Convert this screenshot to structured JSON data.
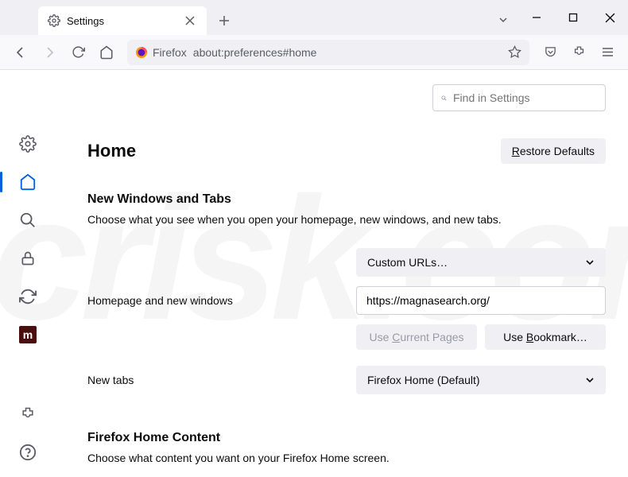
{
  "window": {
    "tab_title": "Settings",
    "chevron": "⌄"
  },
  "toolbar": {
    "url_prefix": "Firefox",
    "url": "about:preferences#home"
  },
  "search": {
    "placeholder": "Find in Settings"
  },
  "page": {
    "title": "Home",
    "restore_label": "Restore Defaults"
  },
  "section1": {
    "title": "New Windows and Tabs",
    "desc": "Choose what you see when you open your homepage, new windows, and new tabs.",
    "dropdown1": "Custom URLs…",
    "homepage_label": "Homepage and new windows",
    "homepage_value": "https://magnasearch.org/",
    "use_current": "Use Current Pages",
    "use_bookmark": "Use Bookmark…",
    "newtabs_label": "New tabs",
    "newtabs_value": "Firefox Home (Default)"
  },
  "section2": {
    "title": "Firefox Home Content",
    "desc": "Choose what content you want on your Firefox Home screen."
  },
  "watermark": "pcrisk.com"
}
